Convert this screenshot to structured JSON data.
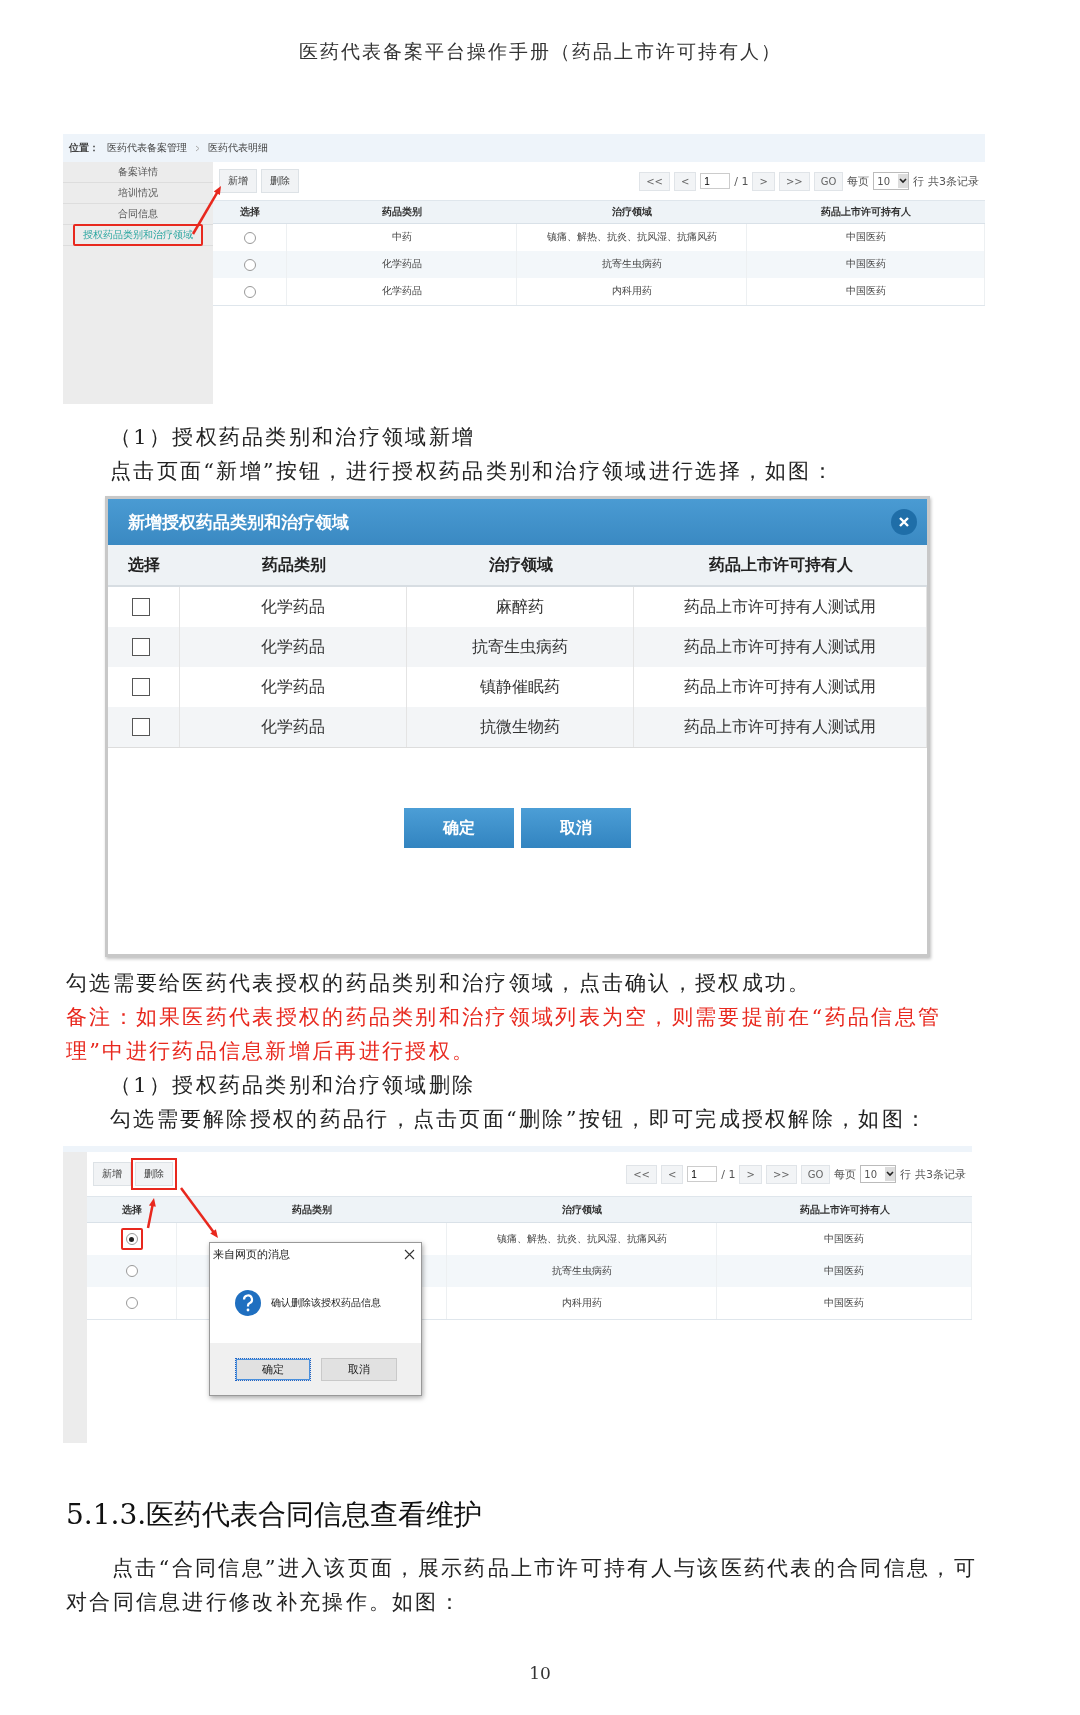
{
  "header": "医药代表备案平台操作手册（药品上市许可持有人）",
  "screenshot_1": {
    "breadcrumb_label": "位置：",
    "breadcrumb": [
      "医药代表备案管理",
      "医药代表明细"
    ],
    "sidebar": [
      {
        "label": "备案详情",
        "selected": false,
        "highlighted": false
      },
      {
        "label": "培训情况",
        "selected": false,
        "highlighted": false
      },
      {
        "label": "合同信息",
        "selected": false,
        "highlighted": false
      },
      {
        "label": "授权药品类别和治疗领域",
        "selected": true,
        "highlighted": true
      }
    ],
    "toolbar": [
      {
        "label": "新增",
        "highlighted": false
      },
      {
        "label": "删除",
        "highlighted": false
      }
    ],
    "pagination": {
      "first": "<<",
      "prev": "<",
      "page": "1",
      "total": "/ 1",
      "next": ">",
      "last": ">>",
      "go": "GO",
      "per_page_label": "每页",
      "per_page": "10",
      "rows_label": "行",
      "summary": "共3条记录"
    },
    "columns": [
      "选择",
      "药品类别",
      "治疗领域",
      "药品上市许可持有人"
    ],
    "rows": [
      {
        "selected": false,
        "highlighted": false,
        "cells": [
          "",
          "中药",
          "镇痛、解热、抗炎、抗风湿、抗痛风药",
          "中国医药"
        ]
      },
      {
        "selected": false,
        "highlighted": false,
        "cells": [
          "",
          "化学药品",
          "抗寄生虫病药",
          "中国医药"
        ]
      },
      {
        "selected": false,
        "highlighted": false,
        "cells": [
          "",
          "化学药品",
          "内科用药",
          "中国医药"
        ]
      }
    ]
  },
  "step_add_title": "（1）授权药品类别和治疗领域新增",
  "step_add_text": "点击页面“新增”按钮，进行授权药品类别和治疗领域进行选择，如图：",
  "add_dialog": {
    "title": "新增授权药品类别和治疗领域",
    "columns": [
      "选择",
      "药品类别",
      "治疗领域",
      "药品上市许可持有人"
    ],
    "rows": [
      {
        "checked": false,
        "cells": [
          "",
          "化学药品",
          "麻醉药",
          "药品上市许可持有人测试用"
        ]
      },
      {
        "checked": false,
        "cells": [
          "",
          "化学药品",
          "抗寄生虫病药",
          "药品上市许可持有人测试用"
        ]
      },
      {
        "checked": false,
        "cells": [
          "",
          "化学药品",
          "镇静催眠药",
          "药品上市许可持有人测试用"
        ]
      },
      {
        "checked": false,
        "cells": [
          "",
          "化学药品",
          "抗微生物药",
          "药品上市许可持有人测试用"
        ]
      }
    ],
    "buttons": [
      "确定",
      "取消"
    ]
  },
  "add_result": "勾选需要给医药代表授权的药品类别和治疗领域，点击确认，授权成功。",
  "note": "备注：如果医药代表授权的药品类别和治疗领域列表为空，则需要提前在“药品信息管理”中进行药品信息新增后再进行授权。",
  "step_delete_title": "（1）授权药品类别和治疗领域删除",
  "step_delete_text": "勾选需要解除授权的药品行，点击页面“删除”按钮，即可完成授权解除，如图：",
  "screenshot_2": {
    "toolbar": [
      {
        "label": "新增",
        "highlighted": false
      },
      {
        "label": "删除",
        "highlighted": true
      }
    ],
    "pagination": {
      "first": "<<",
      "prev": "<",
      "page": "1",
      "total": "/ 1",
      "next": ">",
      "last": ">>",
      "go": "GO",
      "per_page_label": "每页",
      "per_page": "10",
      "rows_label": "行",
      "summary": "共3条记录"
    },
    "columns": [
      "选择",
      "药品类别",
      "治疗领域",
      "药品上市许可持有人"
    ],
    "rows": [
      {
        "selected": true,
        "highlighted": true,
        "cells": [
          "",
          "",
          "镇痛、解热、抗炎、抗风湿、抗痛风药",
          "中国医药"
        ]
      },
      {
        "selected": false,
        "highlighted": false,
        "cells": [
          "",
          "",
          "抗寄生虫病药",
          "中国医药"
        ]
      },
      {
        "selected": false,
        "highlighted": false,
        "cells": [
          "",
          "",
          "内科用药",
          "中国医药"
        ]
      }
    ],
    "message_box": {
      "title": "来自网页的消息",
      "message": "确认删除该授权药品信息",
      "buttons": [
        {
          "label": "确定",
          "focused": true
        },
        {
          "label": "取消",
          "focused": false
        }
      ]
    }
  },
  "section_heading": "5.1.3.医药代表合同信息查看维护",
  "section_text": "点击“合同信息”进入该页面，展示药品上市许可持有人与该医药代表的合同信息，可对合同信息进行修改补充操作。如图：",
  "page_number": "10"
}
